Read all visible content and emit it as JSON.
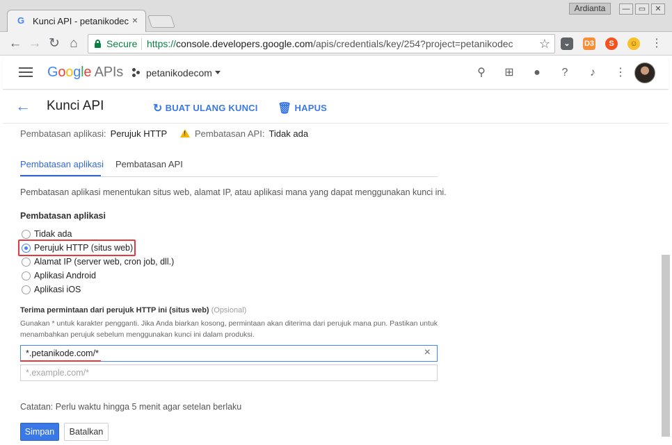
{
  "browser": {
    "tab_title": "Kunci API - petanikodec",
    "user_name": "Ardianta",
    "secure_label": "Secure",
    "url_scheme": "https://",
    "url_host": "console.developers.google.com",
    "url_path": "/apis/credentials/key/254?project=petanikodec",
    "extensions": [
      "pocket-icon",
      "d3-icon",
      "flow-icon",
      "emoji-icon"
    ]
  },
  "appbar": {
    "logo_google": "Google",
    "logo_apis": " APIs",
    "project_name": "petanikodecom"
  },
  "page": {
    "title": "Kunci API",
    "regenerate_label": "BUAT ULANG KUNCI",
    "delete_label": "HAPUS"
  },
  "summary": {
    "app_restriction_label": "Pembatasan aplikasi:",
    "app_restriction_value": "Perujuk HTTP",
    "api_restriction_label": "Pembatasan API:",
    "api_restriction_value": "Tidak ada"
  },
  "tabs": [
    "Pembatasan aplikasi",
    "Pembatasan API"
  ],
  "description": "Pembatasan aplikasi menentukan situs web, alamat IP, atau aplikasi mana yang dapat menggunakan kunci ini.",
  "restriction": {
    "title": "Pembatasan aplikasi",
    "options": [
      "Tidak ada",
      "Perujuk HTTP (situs web)",
      "Alamat IP (server web, cron job, dll.)",
      "Aplikasi Android",
      "Aplikasi iOS"
    ],
    "selected": "Perujuk HTTP (situs web)"
  },
  "referrers": {
    "title": "Terima permintaan dari perujuk HTTP ini (situs web)",
    "optional": "(Opsional)",
    "help": "Gunakan * untuk karakter pengganti. Jika Anda biarkan kosong, permintaan akan diterima dari perujuk mana pun. Pastikan untuk menambahkan perujuk sebelum menggunakan kunci ini dalam produksi.",
    "value": "*.petanikode.com/*",
    "placeholder": "*.example.com/*"
  },
  "note": "Catatan: Perlu waktu hingga 5 menit agar setelan berlaku",
  "buttons": {
    "save": "Simpan",
    "cancel": "Batalkan"
  },
  "colors": {
    "accent": "#4285f4",
    "primary_button": "#3b78e7",
    "highlight": "#e5393e",
    "secure": "#0b8043",
    "warning": "#f4b400"
  }
}
